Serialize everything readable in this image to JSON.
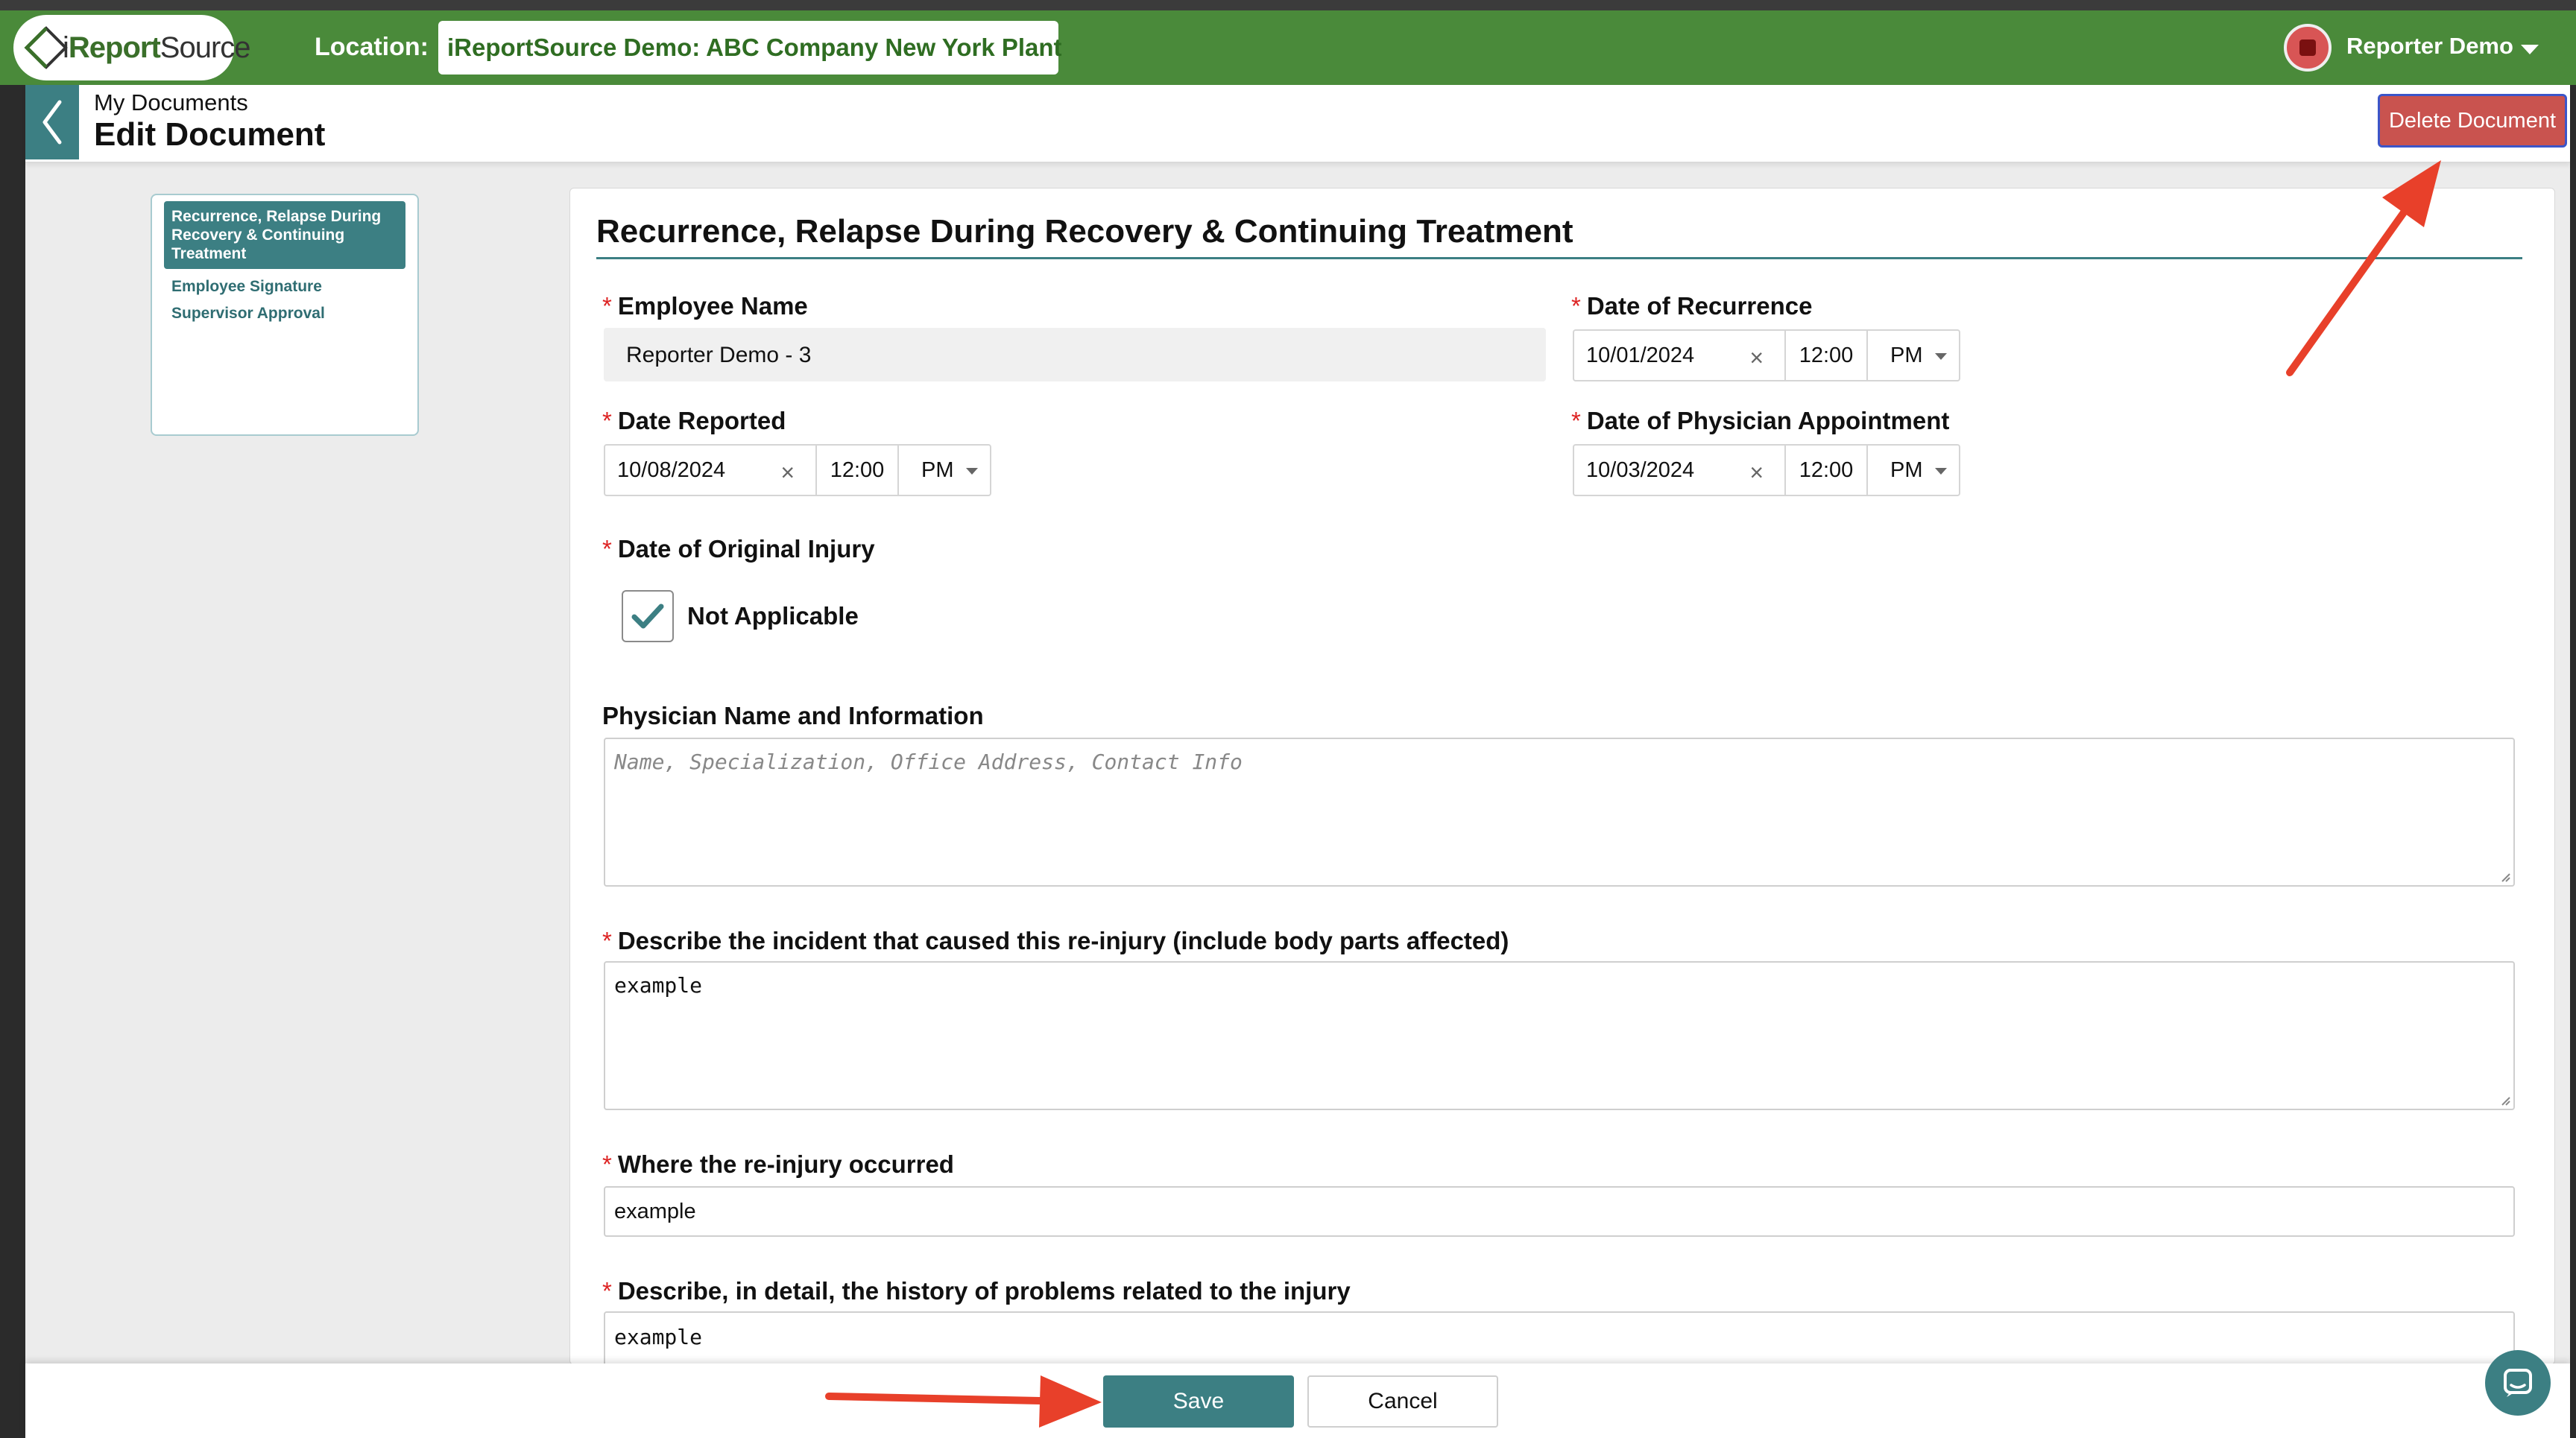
{
  "topbar": {
    "logo_i": "i",
    "logo_report": "Report",
    "logo_source": "Source",
    "location_label": "Location:",
    "location_value": "iReportSource Demo: ABC Company New York Plant",
    "user_name": "Reporter Demo"
  },
  "header": {
    "breadcrumb": "My Documents",
    "title": "Edit Document",
    "delete_label": "Delete Document"
  },
  "sidenav": {
    "items": [
      {
        "label": "Recurrence, Relapse During Recovery & Continuing Treatment",
        "active": true
      },
      {
        "label": "Employee Signature",
        "active": false
      },
      {
        "label": "Supervisor Approval",
        "active": false
      }
    ]
  },
  "form": {
    "section_title": "Recurrence, Relapse During Recovery & Continuing Treatment",
    "required_mark": "*",
    "employee_name": {
      "label": "Employee Name",
      "value": "Reporter Demo - 3"
    },
    "date_recurrence": {
      "label": "Date of Recurrence",
      "date": "10/01/2024",
      "time": "12:00",
      "ampm": "PM"
    },
    "date_reported": {
      "label": "Date Reported",
      "date": "10/08/2024",
      "time": "12:00",
      "ampm": "PM"
    },
    "date_physician": {
      "label": "Date of Physician Appointment",
      "date": "10/03/2024",
      "time": "12:00",
      "ampm": "PM"
    },
    "date_original_injury": {
      "label": "Date of Original Injury",
      "checkbox_label": "Not Applicable",
      "checked": true
    },
    "physician_info": {
      "label": "Physician Name and Information",
      "value": "",
      "placeholder": "Name, Specialization, Office Address, Contact Info"
    },
    "incident_description": {
      "label": "Describe the incident that caused this re-injury (include body parts affected)",
      "value": "example"
    },
    "reinjury_location": {
      "label": "Where the re-injury occurred",
      "value": "example"
    },
    "history": {
      "label": "Describe, in detail, the history of problems related to the injury",
      "value": "example"
    }
  },
  "footer": {
    "save_label": "Save",
    "cancel_label": "Cancel"
  },
  "icons": {
    "clear": "×"
  },
  "colors": {
    "topbar": "#4a8a3a",
    "accent": "#3c7f83",
    "danger": "#c9534f",
    "annotation_arrow": "#e8402a"
  }
}
